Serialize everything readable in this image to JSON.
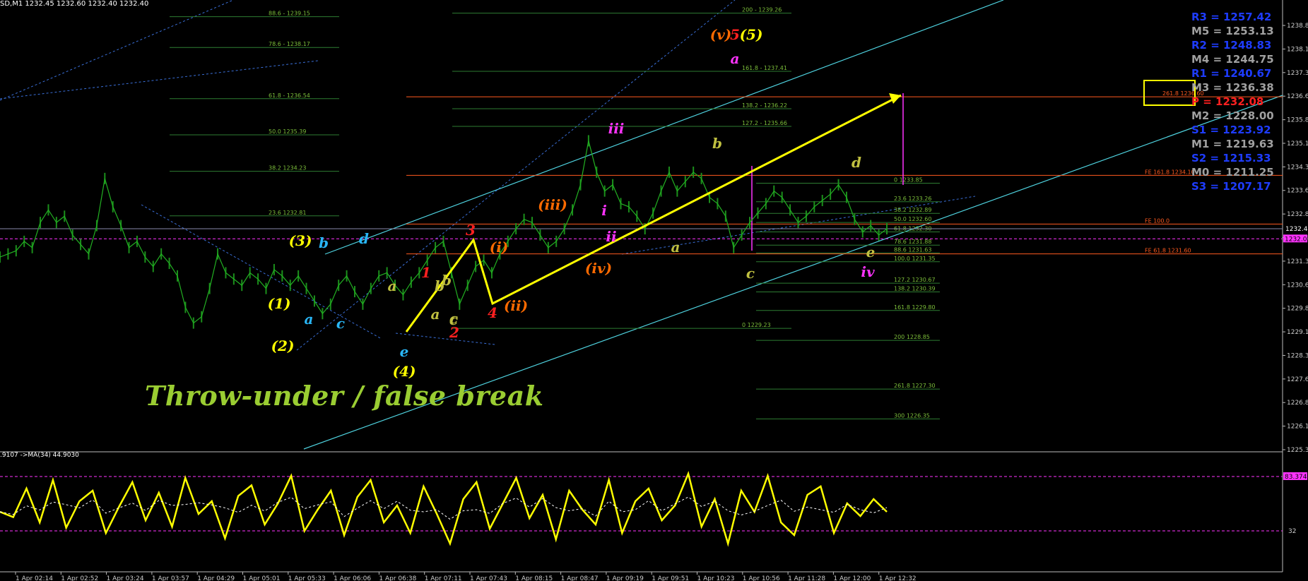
{
  "header": {
    "symbol_text": "SD,M1  1232.45 1232.60 1232.40 1232.40",
    "oscillator_text": ".9107  ->MA(34) 44.9030"
  },
  "annotation_title": "Throw-under / false break",
  "pivots": [
    {
      "label": "R3 = 1257.42",
      "color": "#1e3cff"
    },
    {
      "label": "M5 = 1253.13",
      "color": "#a0a0a0"
    },
    {
      "label": "R2 = 1248.83",
      "color": "#1e3cff"
    },
    {
      "label": "M4 = 1244.75",
      "color": "#a0a0a0"
    },
    {
      "label": "R1 = 1240.67",
      "color": "#1e3cff"
    },
    {
      "label": "M3 = 1236.38",
      "color": "#a0a0a0"
    },
    {
      "label": "P = 1232.08",
      "color": "#ff2020"
    },
    {
      "label": "M2 = 1228.00",
      "color": "#a0a0a0"
    },
    {
      "label": "S1 = 1223.92",
      "color": "#1e3cff"
    },
    {
      "label": "M1 = 1219.63",
      "color": "#a0a0a0"
    },
    {
      "label": "S2 = 1215.33",
      "color": "#1e3cff"
    },
    {
      "label": "M0 = 1211.25",
      "color": "#a0a0a0"
    },
    {
      "label": "S3 = 1207.17",
      "color": "#1e3cff"
    }
  ],
  "chart_data": {
    "type": "line",
    "main": {
      "ylim": [
        1225.37,
        1239.5
      ],
      "y_ticks": [
        1238.87,
        1238.12,
        1237.37,
        1236.62,
        1235.87,
        1235.12,
        1234.37,
        1233.62,
        1232.87,
        1232.12,
        1231.37,
        1230.62,
        1229.87,
        1229.12,
        1228.37,
        1227.62,
        1226.87,
        1226.12,
        1225.37
      ],
      "current_price": "1232.40",
      "pivot_price": "1232.08",
      "closes": [
        1231.5,
        1231.6,
        1231.7,
        1232.0,
        1231.8,
        1232.6,
        1233.0,
        1232.6,
        1232.8,
        1232.2,
        1231.9,
        1231.6,
        1232.5,
        1234.0,
        1233.1,
        1232.5,
        1231.8,
        1232.0,
        1231.5,
        1231.2,
        1231.6,
        1231.3,
        1230.9,
        1229.9,
        1229.4,
        1229.6,
        1230.5,
        1231.6,
        1231.0,
        1230.8,
        1230.6,
        1231.0,
        1230.8,
        1230.5,
        1231.1,
        1230.9,
        1230.6,
        1230.9,
        1230.5,
        1230.1,
        1229.7,
        1230.0,
        1230.6,
        1230.9,
        1230.4,
        1230.0,
        1230.5,
        1230.9,
        1231.0,
        1230.6,
        1230.3,
        1230.7,
        1231.0,
        1231.4,
        1231.8,
        1232.0,
        1231.0,
        1230.0,
        1230.6,
        1231.2,
        1231.4,
        1231.0,
        1231.6,
        1232.0,
        1232.4,
        1232.7,
        1232.6,
        1232.2,
        1231.8,
        1232.0,
        1232.4,
        1233.0,
        1233.8,
        1235.2,
        1234.2,
        1233.6,
        1233.8,
        1233.2,
        1233.1,
        1232.8,
        1232.4,
        1232.9,
        1233.6,
        1234.2,
        1233.6,
        1233.9,
        1234.2,
        1234.0,
        1233.4,
        1233.2,
        1232.8,
        1231.8,
        1232.2,
        1232.6,
        1232.9,
        1233.2,
        1233.6,
        1233.4,
        1233.0,
        1232.6,
        1232.8,
        1233.1,
        1233.3,
        1233.5,
        1233.8,
        1233.4,
        1232.7,
        1232.3,
        1232.5,
        1232.2,
        1232.4
      ],
      "time_labels": [
        "1 Apr 02:14",
        "1 Apr 02:52",
        "1 Apr 03:24",
        "1 Apr 03:57",
        "1 Apr 04:29",
        "1 Apr 05:01",
        "1 Apr 05:33",
        "1 Apr 06:06",
        "1 Apr 06:38",
        "1 Apr 07:11",
        "1 Apr 07:43",
        "1 Apr 08:15",
        "1 Apr 08:47",
        "1 Apr 09:19",
        "1 Apr 09:51",
        "1 Apr 10:23",
        "1 Apr 10:56",
        "1 Apr 11:28",
        "1 Apr 12:00",
        "1 Apr 12:32"
      ],
      "fib_left": [
        {
          "label": "88.6 - 1239.15",
          "y": 1239.15
        },
        {
          "label": "78.6 - 1238.17",
          "y": 1238.17
        },
        {
          "label": "61.8 - 1236.54",
          "y": 1236.54
        },
        {
          "label": "50.0 1235.39",
          "y": 1235.39
        },
        {
          "label": "38.2 1234.23",
          "y": 1234.23
        },
        {
          "label": "23.6 1232.81",
          "y": 1232.81
        }
      ],
      "fib_mid": [
        {
          "label": "200 - 1239.26",
          "y": 1239.26
        },
        {
          "label": "161.8 - 1237.41",
          "y": 1237.41
        },
        {
          "label": "138.2 - 1236.22",
          "y": 1236.22
        },
        {
          "label": "127.2 - 1235.66",
          "y": 1235.66
        },
        {
          "label": "0 1229.23",
          "y": 1229.23
        }
      ],
      "fib_right": [
        {
          "label": "0 1233.85",
          "y": 1233.85
        },
        {
          "label": "23.6 1233.26",
          "y": 1233.26
        },
        {
          "label": "38.2 1232.89",
          "y": 1232.89
        },
        {
          "label": "50.0 1232.60",
          "y": 1232.6
        },
        {
          "label": "61.8 1232.30",
          "y": 1232.3
        },
        {
          "label": "78.6 1231.88",
          "y": 1231.88
        },
        {
          "label": "88.6 1231.63",
          "y": 1231.63
        },
        {
          "label": "100.0 1231.35",
          "y": 1231.35
        },
        {
          "label": "127.2 1230.67",
          "y": 1230.67
        },
        {
          "label": "138.2 1230.39",
          "y": 1230.39
        },
        {
          "label": "161.8 1229.80",
          "y": 1229.8
        },
        {
          "label": "200 1228.85",
          "y": 1228.85
        },
        {
          "label": "261.8 1227.30",
          "y": 1227.3
        },
        {
          "label": "300 1226.35",
          "y": 1226.35
        }
      ],
      "fe_lines": [
        {
          "label": "261.8 1236.60",
          "y": 1236.6
        },
        {
          "label": "FE 161.8 1234.10",
          "y": 1234.1
        },
        {
          "label": "FE 100.0",
          "y": 1232.55
        },
        {
          "label": "FE 61.8 1231.60",
          "y": 1231.6
        }
      ],
      "wave_labels": [
        {
          "text": "(1)",
          "color": "#ffff00"
        },
        {
          "text": "(2)",
          "color": "#ffff00"
        },
        {
          "text": "(3)",
          "color": "#ffff00"
        },
        {
          "text": "(4)",
          "color": "#ffff00"
        },
        {
          "text": "(5)",
          "color": "#ffff00"
        },
        {
          "text": "(v)",
          "color": "#ff6a00"
        },
        {
          "text": "(i)",
          "color": "#ff6a00"
        },
        {
          "text": "(ii)",
          "color": "#ff6a00"
        },
        {
          "text": "(iii)",
          "color": "#ff6a00"
        },
        {
          "text": "(iv)",
          "color": "#ff6a00"
        },
        {
          "text": "1",
          "color": "#ff2020"
        },
        {
          "text": "2",
          "color": "#ff2020"
        },
        {
          "text": "3",
          "color": "#ff2020"
        },
        {
          "text": "4",
          "color": "#ff2020"
        },
        {
          "text": "5",
          "color": "#ff2020"
        },
        {
          "text": "i",
          "color": "#ff33ff"
        },
        {
          "text": "ii",
          "color": "#ff33ff"
        },
        {
          "text": "iii",
          "color": "#ff33ff"
        },
        {
          "text": "iv",
          "color": "#ff33ff"
        },
        {
          "text": "a",
          "color": "#ff33ff"
        },
        {
          "text": "a",
          "color": "#29b6f6"
        },
        {
          "text": "b",
          "color": "#29b6f6"
        },
        {
          "text": "c",
          "color": "#29b6f6"
        },
        {
          "text": "d",
          "color": "#29b6f6"
        },
        {
          "text": "e",
          "color": "#29b6f6"
        },
        {
          "text": "a",
          "color": "#c0c040"
        },
        {
          "text": "b",
          "color": "#c0c040"
        },
        {
          "text": "c",
          "color": "#c0c040"
        },
        {
          "text": "a",
          "color": "#c0c040"
        },
        {
          "text": "b",
          "color": "#c0c040"
        },
        {
          "text": "c",
          "color": "#c0c040"
        },
        {
          "text": "a",
          "color": "#c0c040"
        },
        {
          "text": "b",
          "color": "#c0c040"
        },
        {
          "text": "c",
          "color": "#c0c040"
        },
        {
          "text": "d",
          "color": "#c0c040"
        },
        {
          "text": "e",
          "color": "#c0c040"
        }
      ]
    },
    "oscillator": {
      "top_label": "83.3745",
      "level_label": "32",
      "ma_period": 34,
      "ma_value": 44.903,
      "values": [
        50,
        45,
        72,
        40,
        80,
        35,
        60,
        70,
        30,
        55,
        78,
        42,
        68,
        36,
        82,
        48,
        60,
        25,
        65,
        75,
        38,
        58,
        84,
        32,
        52,
        70,
        28,
        64,
        80,
        40,
        56,
        30,
        74,
        48,
        20,
        62,
        78,
        34,
        58,
        82,
        44,
        66,
        24,
        70,
        52,
        38,
        80,
        30,
        60,
        72,
        42,
        56,
        86,
        36,
        62,
        20,
        70,
        50,
        84,
        40,
        28,
        66,
        74,
        30,
        58,
        46,
        62,
        50
      ]
    }
  }
}
